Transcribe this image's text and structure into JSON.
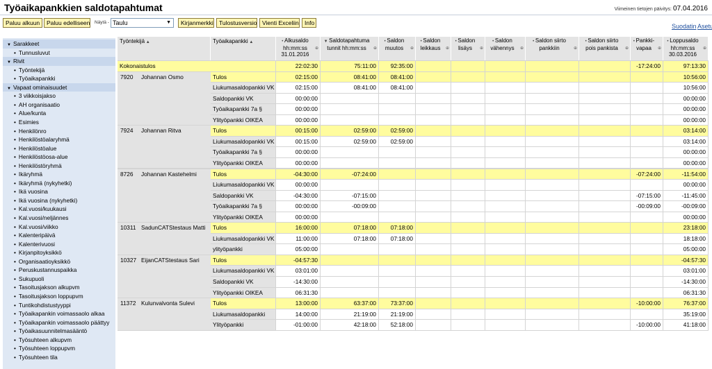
{
  "header": {
    "title": "Työaikapankkien saldotapahtumat",
    "update_label": "Viimeinen tietojen päivitys:",
    "update_date": "07.04.2016"
  },
  "toolbar": {
    "buttons": [
      "Paluu alkuun",
      "Paluu edelliseen",
      "Kirjanmerkki",
      "Tulostusversio",
      "Vienti Exceliin",
      "Info"
    ],
    "view_label": "Näytä -",
    "view_value": "Taulu",
    "links": [
      "Suodatin",
      "Asetu"
    ]
  },
  "sidebar": {
    "sections": [
      {
        "label": "Sarakkeet",
        "items": [
          "Tunnusluvut"
        ]
      },
      {
        "label": "Rivit",
        "items": [
          "Työntekijä",
          "Työaikapankki"
        ]
      },
      {
        "label": "Vapaat ominaisuudet",
        "items": [
          "3 viikkoisjakso",
          "AH organisaatio",
          "Alue/kunta",
          "Esimies",
          "Henkilönro",
          "Henkilöstöalaryhmä",
          "Henkilöstöalue",
          "Henkilöstöosa-alue",
          "Henkilöstöryhmä",
          "Ikäryhmä",
          "Ikäryhmä (nykyhetki)",
          "Ikä vuosina",
          "Ikä vuosina (nykyhetki)",
          "Kal.vuosi/kuukausi",
          "Kal.vuosi/neljännes",
          "Kal.vuosi/viikko",
          "Kalenteripäivä",
          "Kalenterivuosi",
          "Kirjanpitoyksikkö",
          "Organisaatioyksikkö",
          "Peruskustannuspaikka",
          "Sukupuoli",
          "Tasoitusjakson alkupvm",
          "Tasoitusjakson loppupvm",
          "Tuntikohdistustyyppi",
          "Työaikapankin voimassaolo alkaa",
          "Työaikapankin voimassaolo päättyy",
          "Työaikasuunnitelmasääntö",
          "Työsuhteen alkupvm",
          "Työsuhteen loppupvm",
          "Työsuhteen tila"
        ]
      }
    ]
  },
  "grid": {
    "headers": [
      "Työntekijä",
      "Työaikapankki",
      "Alkusaldo hh:mm:ss 31.01.2016",
      "Saldotapahtuma tunnit hh:mm:ss",
      "Saldon muutos",
      "Saldon leikkaus",
      "Saldon lisäys",
      "Saldon vähennys",
      "Saldon siirto pankkiin",
      "Saldon siirto pois pankista",
      "Pankki-vapaa",
      "Loppusaldo hh:mm:ss 30.03.2016"
    ],
    "overall": {
      "label": "Kokonaistulos",
      "values": [
        "22:02:30",
        "75:11:00",
        "92:35:00",
        "",
        "",
        "",
        "",
        "",
        "-17:24:00",
        "97:13:30"
      ]
    },
    "employees": [
      {
        "id": "7920",
        "name": "Johannan Osmo",
        "rows": [
          {
            "label": "Tulos",
            "total": true,
            "values": [
              "02:15:00",
              "08:41:00",
              "08:41:00",
              "",
              "",
              "",
              "",
              "",
              "",
              "10:56:00"
            ]
          },
          {
            "label": "Liukumasaldopankki VK",
            "values": [
              "02:15:00",
              "08:41:00",
              "08:41:00",
              "",
              "",
              "",
              "",
              "",
              "",
              "10:56:00"
            ]
          },
          {
            "label": "Saldopankki VK",
            "values": [
              "00:00:00",
              "",
              "",
              "",
              "",
              "",
              "",
              "",
              "",
              "00:00:00"
            ]
          },
          {
            "label": "Työaikapankki 7a §",
            "values": [
              "00:00:00",
              "",
              "",
              "",
              "",
              "",
              "",
              "",
              "",
              "00:00:00"
            ]
          },
          {
            "label": "Ylityöpankki OIKEA",
            "values": [
              "00:00:00",
              "",
              "",
              "",
              "",
              "",
              "",
              "",
              "",
              "00:00:00"
            ]
          }
        ]
      },
      {
        "id": "7924",
        "name": "Johannan Ritva",
        "rows": [
          {
            "label": "Tulos",
            "total": true,
            "values": [
              "00:15:00",
              "02:59:00",
              "02:59:00",
              "",
              "",
              "",
              "",
              "",
              "",
              "03:14:00"
            ]
          },
          {
            "label": "Liukumasaldopankki VK",
            "values": [
              "00:15:00",
              "02:59:00",
              "02:59:00",
              "",
              "",
              "",
              "",
              "",
              "",
              "03:14:00"
            ]
          },
          {
            "label": "Työaikapankki 7a §",
            "values": [
              "00:00:00",
              "",
              "",
              "",
              "",
              "",
              "",
              "",
              "",
              "00:00:00"
            ]
          },
          {
            "label": "Ylityöpankki OIKEA",
            "values": [
              "00:00:00",
              "",
              "",
              "",
              "",
              "",
              "",
              "",
              "",
              "00:00:00"
            ]
          }
        ]
      },
      {
        "id": "8726",
        "name": "Johannan Kastehelmi",
        "rows": [
          {
            "label": "Tulos",
            "total": true,
            "values": [
              "-04:30:00",
              "-07:24:00",
              "",
              "",
              "",
              "",
              "",
              "",
              "-07:24:00",
              "-11:54:00"
            ]
          },
          {
            "label": "Liukumasaldopankki VK",
            "values": [
              "00:00:00",
              "",
              "",
              "",
              "",
              "",
              "",
              "",
              "",
              "00:00:00"
            ]
          },
          {
            "label": "Saldopankki VK",
            "values": [
              "-04:30:00",
              "-07:15:00",
              "",
              "",
              "",
              "",
              "",
              "",
              "-07:15:00",
              "-11:45:00"
            ]
          },
          {
            "label": "Työaikapankki 7a §",
            "values": [
              "00:00:00",
              "-00:09:00",
              "",
              "",
              "",
              "",
              "",
              "",
              "-00:09:00",
              "-00:09:00"
            ]
          },
          {
            "label": "Ylityöpankki OIKEA",
            "values": [
              "00:00:00",
              "",
              "",
              "",
              "",
              "",
              "",
              "",
              "",
              "00:00:00"
            ]
          }
        ]
      },
      {
        "id": "10311",
        "name": "SadunCATStestaus Matti",
        "rows": [
          {
            "label": "Tulos",
            "total": true,
            "values": [
              "16:00:00",
              "07:18:00",
              "07:18:00",
              "",
              "",
              "",
              "",
              "",
              "",
              "23:18:00"
            ]
          },
          {
            "label": "Liukumasaldopankki VK",
            "values": [
              "11:00:00",
              "07:18:00",
              "07:18:00",
              "",
              "",
              "",
              "",
              "",
              "",
              "18:18:00"
            ]
          },
          {
            "label": "ylityöpankki",
            "values": [
              "05:00:00",
              "",
              "",
              "",
              "",
              "",
              "",
              "",
              "",
              "05:00:00"
            ]
          }
        ]
      },
      {
        "id": "10327",
        "name": "EijanCATStestaus Sari",
        "rows": [
          {
            "label": "Tulos",
            "total": true,
            "values": [
              "-04:57:30",
              "",
              "",
              "",
              "",
              "",
              "",
              "",
              "",
              "-04:57:30"
            ]
          },
          {
            "label": "Liukumasaldopankki VK",
            "values": [
              "03:01:00",
              "",
              "",
              "",
              "",
              "",
              "",
              "",
              "",
              "03:01:00"
            ]
          },
          {
            "label": "Saldopankki VK",
            "values": [
              "-14:30:00",
              "",
              "",
              "",
              "",
              "",
              "",
              "",
              "",
              "-14:30:00"
            ]
          },
          {
            "label": "Ylityöpankki OIKEA",
            "values": [
              "06:31:30",
              "",
              "",
              "",
              "",
              "",
              "",
              "",
              "",
              "06:31:30"
            ]
          }
        ]
      },
      {
        "id": "11372",
        "name": "Kulunvalvonta Sulevi",
        "rows": [
          {
            "label": "Tulos",
            "total": true,
            "values": [
              "13:00:00",
              "63:37:00",
              "73:37:00",
              "",
              "",
              "",
              "",
              "",
              "-10:00:00",
              "76:37:00"
            ]
          },
          {
            "label": "Liukumasaldopankki",
            "values": [
              "14:00:00",
              "21:19:00",
              "21:19:00",
              "",
              "",
              "",
              "",
              "",
              "",
              "35:19:00"
            ]
          },
          {
            "label": "Ylityöpankki",
            "values": [
              "-01:00:00",
              "42:18:00",
              "52:18:00",
              "",
              "",
              "",
              "",
              "",
              "-10:00:00",
              "41:18:00"
            ]
          }
        ]
      }
    ]
  }
}
